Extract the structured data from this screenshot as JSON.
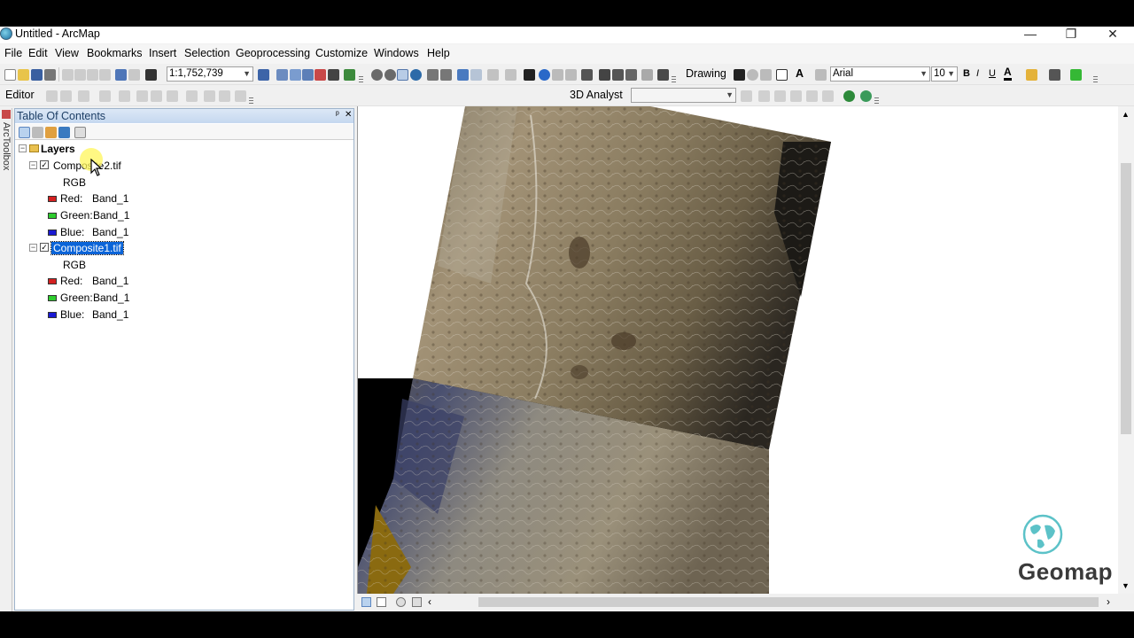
{
  "window": {
    "title": "Untitled - ArcMap",
    "minimize": "—",
    "restore": "❐",
    "close": "✕"
  },
  "menubar": [
    "File",
    "Edit",
    "View",
    "Bookmarks",
    "Insert",
    "Selection",
    "Geoprocessing",
    "Customize",
    "Windows",
    "Help"
  ],
  "toolbar1": {
    "scale": "1:1,752,739",
    "drawing_label": "Drawing",
    "font_name": "Arial",
    "font_size": "10",
    "bold": "B",
    "italic": "I",
    "underline": "U",
    "font_color": "A"
  },
  "toolbar2": {
    "editor_label": "Editor",
    "analyst_label": "3D Analyst",
    "analyst_layer": ""
  },
  "side_strip": {
    "label": "ArcToolbox"
  },
  "toc": {
    "title": "Table Of Contents",
    "pin": "ᵖ",
    "close": "✕",
    "root": "Layers",
    "layers": [
      {
        "name": "Composite2.tif",
        "checked": true,
        "selected": false,
        "renderer": "RGB",
        "bands": [
          {
            "channel": "Red:",
            "band": "Band_1",
            "color": "#d42020"
          },
          {
            "channel": "Green:",
            "band": "Band_1",
            "color": "#2ecc2e"
          },
          {
            "channel": "Blue:",
            "band": "Band_1",
            "color": "#1a1ad4"
          }
        ]
      },
      {
        "name": "Composite1.tif",
        "checked": true,
        "selected": true,
        "renderer": "RGB",
        "bands": [
          {
            "channel": "Red:",
            "band": "Band_1",
            "color": "#d42020"
          },
          {
            "channel": "Green:",
            "band": "Band_1",
            "color": "#2ecc2e"
          },
          {
            "channel": "Blue:",
            "band": "Band_1",
            "color": "#1a1ad4"
          }
        ]
      }
    ]
  },
  "logo": {
    "text": "Geomap"
  },
  "colors": {
    "selection": "#0a64d8",
    "toc_header": "#c5d8ef",
    "nodata": "#000000"
  }
}
